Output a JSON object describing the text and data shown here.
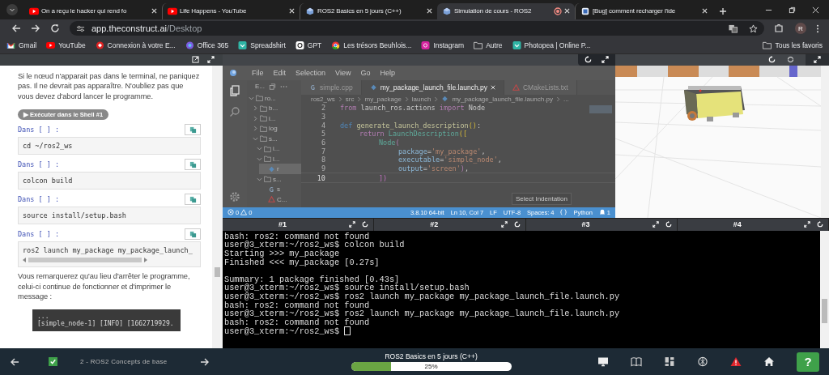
{
  "browser": {
    "tabs": [
      {
        "title": "On a reçu le hacker qui rend fo",
        "kind": "youtube",
        "recording": false,
        "selected": false
      },
      {
        "title": "Life Happens - YouTube",
        "kind": "youtube",
        "recording": false,
        "selected": false
      },
      {
        "title": "ROS2 Basics en 5 jours (C++)",
        "kind": "construct",
        "recording": false,
        "selected": false
      },
      {
        "title": "Simulation de cours - ROS2",
        "kind": "construct",
        "recording": true,
        "selected": true
      },
      {
        "title": "[Bug] comment recharger l'ide",
        "kind": "bug",
        "recording": false,
        "selected": false
      }
    ],
    "address": "app.theconstruct.ai/Desktop",
    "profile_initial": "R",
    "bookmarks": [
      {
        "label": "Gmail",
        "kind": "gmail"
      },
      {
        "label": "YouTube",
        "kind": "youtube"
      },
      {
        "label": "Connexion à votre E...",
        "kind": "red"
      },
      {
        "label": "Office 365",
        "kind": "office"
      },
      {
        "label": "Spreadshirt",
        "kind": "teal"
      },
      {
        "label": "GPT",
        "kind": "gpt"
      },
      {
        "label": "Les trésors Beuhlois...",
        "kind": "chrome"
      },
      {
        "label": "Instagram",
        "kind": "instagram"
      },
      {
        "label": "Autre",
        "kind": "folder"
      },
      {
        "label": "Photopea | Online P...",
        "kind": "teal"
      }
    ],
    "all_bookmarks": "Tous les favoris"
  },
  "notebook": {
    "intro": "Si le nœud n'apparait pas dans le terminal, ne paniquez pas. Il ne devrait pas apparaître. N'oubliez pas que vous devez d'abord lancer le programme.",
    "run_button": "▶ Exécuter dans le Shell #1",
    "cells": [
      {
        "prompt": "Dans [ ] :",
        "code": "cd ~/ros2_ws",
        "scrollable": false
      },
      {
        "prompt": "Dans [ ] :",
        "code": "colcon build",
        "scrollable": false
      },
      {
        "prompt": "Dans [ ] :",
        "code": "source install/setup.bash",
        "scrollable": false
      },
      {
        "prompt": "Dans [ ] :",
        "code": "ros2 launch my_package my_package_launch_",
        "scrollable": true
      }
    ],
    "note": "Vous remarquerez qu'au lieu d'arrêter le programme, celui-ci continue de fonctionner et d'imprimer le message :",
    "output": [
      "...",
      "[simple_node-1] [INFO] [1662719929."
    ]
  },
  "editor": {
    "menu": [
      "File",
      "Edit",
      "Selection",
      "View",
      "Go",
      "Help"
    ],
    "explorer_title": "E...",
    "tree": [
      {
        "label": "ro...",
        "kind": "folder",
        "expanded": true,
        "selected": false,
        "children": [
          {
            "label": "b...",
            "kind": "folder",
            "expanded": false,
            "selected": false
          },
          {
            "label": "i...",
            "kind": "folder",
            "expanded": false,
            "selected": false
          },
          {
            "label": "log",
            "kind": "folder",
            "expanded": false,
            "selected": false
          },
          {
            "label": "s...",
            "kind": "folder",
            "expanded": true,
            "selected": false,
            "children": [
              {
                "label": "i...",
                "kind": "folder",
                "expanded": true,
                "selected": false
              },
              {
                "label": "l...",
                "kind": "folder",
                "expanded": true,
                "selected": false,
                "children": [
                  {
                    "label": "r",
                    "kind": "python",
                    "selected": true
                  }
                ]
              },
              {
                "label": "s...",
                "kind": "folder",
                "expanded": true,
                "selected": false,
                "children": [
                  {
                    "label": "s",
                    "kind": "cpp",
                    "selected": false
                  },
                  {
                    "label": "C...",
                    "kind": "cmake",
                    "selected": false
                  }
                ]
              }
            ]
          }
        ]
      }
    ],
    "tabs": [
      {
        "label": "simple.cpp",
        "kind": "cpp",
        "selected": false
      },
      {
        "label": "my_package_launch_file.launch.py",
        "kind": "python",
        "selected": true
      },
      {
        "label": "CMakeLists.txt",
        "kind": "cmake",
        "selected": false
      }
    ],
    "breadcrumb": [
      "ros2_ws",
      "src",
      "my_package",
      "launch",
      "my_package_launch_file.launch.py",
      "..."
    ],
    "code": [
      {
        "number": "2",
        "current": false,
        "kind": "top",
        "tokens": [
          {
            "kind": "keyword",
            "text": "from"
          },
          {
            "kind": "plain",
            "text": " launch_ros.actions "
          },
          {
            "kind": "keyword",
            "text": "import"
          },
          {
            "kind": "plain",
            "text": " Node"
          }
        ]
      },
      {
        "number": "3",
        "current": false
      },
      {
        "number": "4",
        "current": false,
        "kind": "top",
        "tokens": [
          {
            "kind": "storage",
            "text": "def "
          },
          {
            "kind": "func",
            "text": "generate_launch_description"
          },
          {
            "kind": "paren",
            "text": "()"
          },
          {
            "kind": "plain",
            "text": ":"
          }
        ]
      },
      {
        "number": "5",
        "current": false,
        "kind": "block",
        "tokens": [
          {
            "kind": "keyword",
            "text": "return "
          },
          {
            "kind": "class",
            "text": "LaunchDescription"
          },
          {
            "kind": "paren",
            "text": "(["
          }
        ]
      },
      {
        "number": "6",
        "current": false,
        "kind": "nested",
        "tokens": [
          {
            "kind": "class",
            "text": "Node"
          },
          {
            "kind": "paren2",
            "text": "("
          }
        ]
      },
      {
        "number": "7",
        "current": false,
        "kind": "args",
        "tokens": [
          {
            "kind": "param",
            "text": "package"
          },
          {
            "kind": "plain",
            "text": "="
          },
          {
            "kind": "string",
            "text": "'my_package'"
          },
          {
            "kind": "plain",
            "text": ","
          }
        ]
      },
      {
        "number": "8",
        "current": false,
        "kind": "args",
        "tokens": [
          {
            "kind": "param",
            "text": "executable"
          },
          {
            "kind": "plain",
            "text": "="
          },
          {
            "kind": "string",
            "text": "'simple_node'"
          },
          {
            "kind": "plain",
            "text": ","
          }
        ]
      },
      {
        "number": "9",
        "current": false,
        "kind": "args",
        "tokens": [
          {
            "kind": "param",
            "text": "output"
          },
          {
            "kind": "plain",
            "text": "="
          },
          {
            "kind": "string",
            "text": "'screen'"
          },
          {
            "kind": "paren2",
            "text": ")"
          },
          {
            "kind": "plain",
            "text": ","
          }
        ]
      },
      {
        "number": "10",
        "current": true,
        "kind": "nested",
        "tokens": [
          {
            "kind": "paren3",
            "text": "])"
          }
        ]
      }
    ],
    "tooltip": "Select Indentation",
    "status": {
      "errors": "0",
      "warnings": "0",
      "items": [
        "3.8.10 64-bit",
        "Ln 10, Col 7",
        "LF",
        "UTF-8",
        "Spaces: 4",
        "Python"
      ],
      "notifications": "1"
    }
  },
  "terminal": {
    "tabs": [
      "#1",
      "#2",
      "#3",
      "#4"
    ],
    "blocks": [
      [
        "bash: ros2: command not found",
        "user@3_xterm:~/ros2_ws$ colcon build",
        "Starting >>> my_package",
        "Finished <<< my_package [0.27s]"
      ],
      [
        "Summary: 1 package finished [0.43s]",
        "user@3_xterm:~/ros2_ws$ source install/setup.bash",
        "user@3_xterm:~/ros2_ws$ ros2 launch my_package my_package_launch_file.launch.py",
        "bash: ros2: command not found",
        "user@3_xterm:~/ros2_ws$ ros2 launch my_package my_package_launch_file.launch.py",
        "bash: ros2: command not found",
        "user@3_xterm:~/ros2_ws$"
      ]
    ],
    "cursor": true
  },
  "footer": {
    "lesson": "2 - ROS2 Concepts de base",
    "lesson_done": true,
    "course": "ROS2 Basics en 5 jours (C++)",
    "progress": {
      "level": 0.25,
      "reading": "25%"
    },
    "help": "?"
  }
}
